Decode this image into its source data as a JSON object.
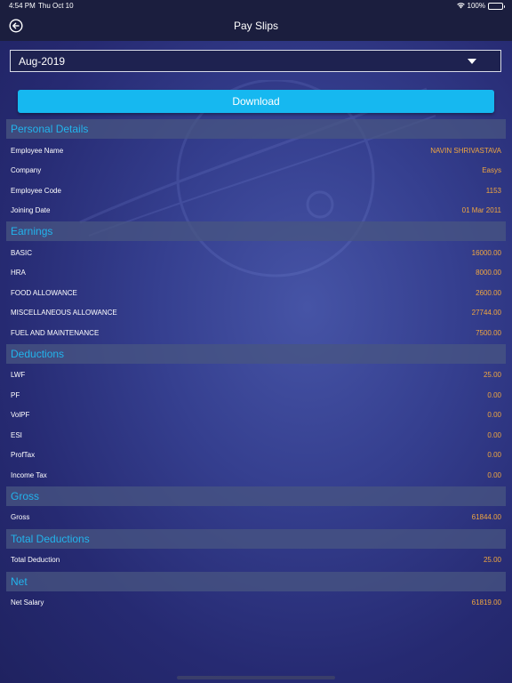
{
  "status_bar": {
    "time": "4:54 PM",
    "date": "Thu Oct 10",
    "battery": "100%"
  },
  "nav": {
    "title": "Pay Slips",
    "back_icon": "back-arrow-circle-icon"
  },
  "month_select": {
    "value": "Aug-2019"
  },
  "download_label": "Download",
  "colors": {
    "accent": "#16b8f0",
    "value": "#f0a640",
    "section_title": "#22b4ec"
  },
  "sections": {
    "personal": {
      "title": "Personal Details",
      "rows": [
        {
          "label": "Employee Name",
          "value": "NAVIN SHRIVASTAVA"
        },
        {
          "label": "Company",
          "value": "Easys"
        },
        {
          "label": "Employee Code",
          "value": "1153"
        },
        {
          "label": "Joining Date",
          "value": "01 Mar 2011"
        }
      ]
    },
    "earnings": {
      "title": "Earnings",
      "rows": [
        {
          "label": "BASIC",
          "value": "16000.00"
        },
        {
          "label": "HRA",
          "value": "8000.00"
        },
        {
          "label": "FOOD ALLOWANCE",
          "value": "2600.00"
        },
        {
          "label": "MISCELLANEOUS ALLOWANCE",
          "value": "27744.00"
        },
        {
          "label": "FUEL AND MAINTENANCE",
          "value": "7500.00"
        }
      ]
    },
    "deductions": {
      "title": "Deductions",
      "rows": [
        {
          "label": "LWF",
          "value": "25.00"
        },
        {
          "label": "PF",
          "value": "0.00"
        },
        {
          "label": "VolPF",
          "value": "0.00"
        },
        {
          "label": "ESI",
          "value": "0.00"
        },
        {
          "label": "ProfTax",
          "value": "0.00"
        },
        {
          "label": "Income Tax",
          "value": "0.00"
        }
      ]
    },
    "gross": {
      "title": "Gross",
      "rows": [
        {
          "label": "Gross",
          "value": "61844.00"
        }
      ]
    },
    "total_deductions": {
      "title": "Total Deductions",
      "rows": [
        {
          "label": "Total Deduction",
          "value": "25.00"
        }
      ]
    },
    "net": {
      "title": "Net",
      "rows": [
        {
          "label": "Net Salary",
          "value": "61819.00"
        }
      ]
    }
  }
}
